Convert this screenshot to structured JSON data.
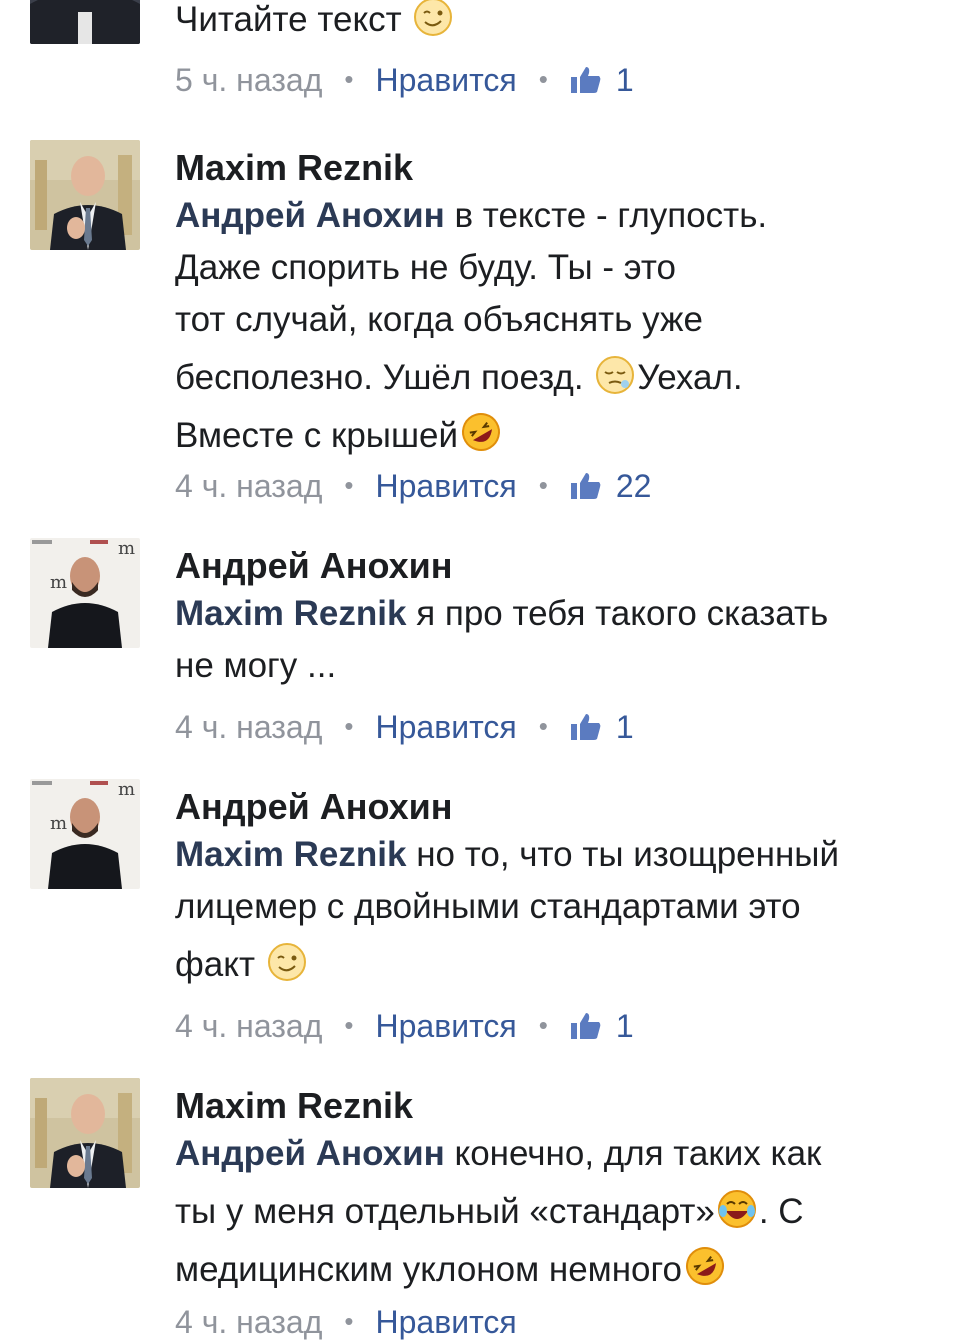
{
  "comments": [
    {
      "author": "",
      "mention": "",
      "lines": [
        "Читайте текст"
      ],
      "time": "5 ч. назад",
      "like_label": "Нравится",
      "likes": "1"
    },
    {
      "author": "Maxim Reznik",
      "mention": "Андрей Анохин",
      "line1": " в тексте - глупость.",
      "line2": "Даже спорить не буду. Ты - это",
      "line3": "тот случай, когда объяснять уже",
      "line4a": "бесполезно. Ушёл поезд. ",
      "line4b": "Уехал.",
      "line5": "Вместе с крышей",
      "time": "4 ч. назад",
      "like_label": "Нравится",
      "likes": "22"
    },
    {
      "author": "Андрей Анохин",
      "mention": "Maxim Reznik",
      "line1": " я про тебя такого сказать",
      "line2": "не могу ...",
      "time": "4 ч. назад",
      "like_label": "Нравится",
      "likes": "1"
    },
    {
      "author": "Андрей Анохин",
      "mention": "Maxim Reznik",
      "line1": " но то, что ты изощренный",
      "line2": "лицемер с двойными стандартами это",
      "line3": "факт ",
      "time": "4 ч. назад",
      "like_label": "Нравится",
      "likes": "1"
    },
    {
      "author": "Maxim Reznik",
      "mention": "Андрей Анохин",
      "line1": " конечно, для таких как",
      "line2a": "ты у меня отдельный «стандарт»",
      "line2b": ". С",
      "line3": "медицинским уклоном немного",
      "time": "4 ч. назад",
      "like_label": "Нравится"
    }
  ],
  "first_line": "Читайте текст",
  "colors": {
    "link": "#365899",
    "mention": "#2b3a55",
    "meta": "#90949c",
    "text": "#1c1e21"
  },
  "icons": [
    "wink-emoji",
    "sleepy-emoji",
    "rofl-emoji",
    "joy-emoji",
    "thumbs-up-icon"
  ]
}
